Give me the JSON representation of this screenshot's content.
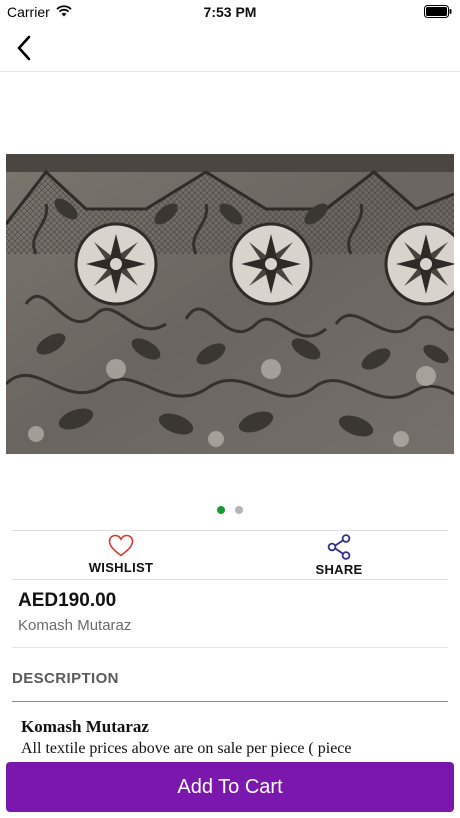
{
  "status_bar": {
    "carrier": "Carrier",
    "time": "7:53 PM"
  },
  "nav": {
    "back_icon": "chevron-left-icon"
  },
  "gallery": {
    "page_count": 2,
    "active_index": 0,
    "active_color": "#179b2a"
  },
  "actions": {
    "wishlist": {
      "label": "WISHLIST",
      "icon": "heart-icon",
      "color": "#d9342b"
    },
    "share": {
      "label": "SHARE",
      "icon": "share-icon",
      "color": "#2c2f8f"
    }
  },
  "product": {
    "price": "AED190.00",
    "name": "Komash Mutaraz"
  },
  "description": {
    "heading": "DESCRIPTION",
    "title": "Komash Mutaraz",
    "body": "All textile prices above are on sale per piece ( piece"
  },
  "cart": {
    "label": "Add To Cart",
    "color": "#7a17ad"
  }
}
